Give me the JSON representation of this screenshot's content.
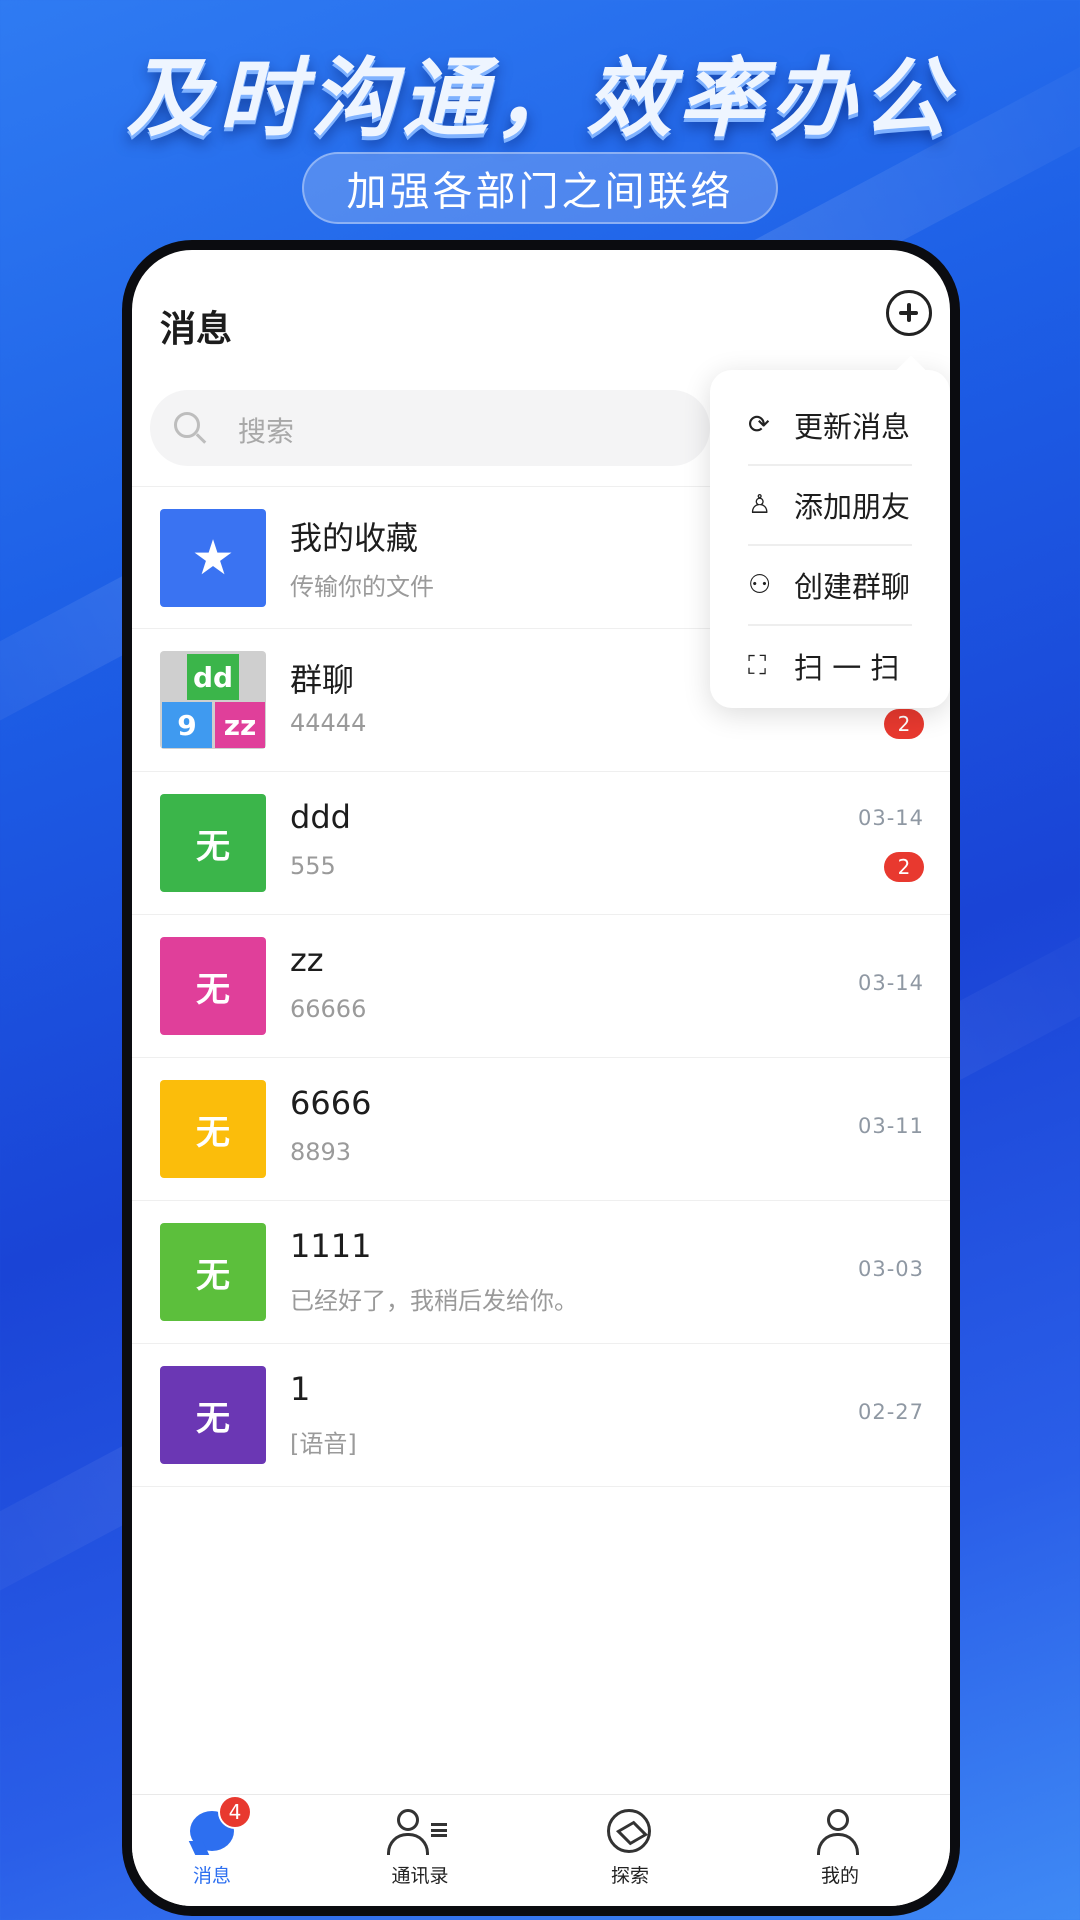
{
  "promo": {
    "headline": "及时沟通，效率办公",
    "subtitle": "加强各部门之间联络"
  },
  "header": {
    "title": "消息",
    "add_icon": "plus-circle-icon"
  },
  "search": {
    "placeholder": "搜索",
    "icon": "search-icon"
  },
  "popup_menu": {
    "items": [
      {
        "label": "更新消息",
        "icon": "refresh-icon",
        "glyph": "⟳"
      },
      {
        "label": "添加朋友",
        "icon": "add-user-icon",
        "glyph": "♙"
      },
      {
        "label": "创建群聊",
        "icon": "group-icon",
        "glyph": "⚇"
      },
      {
        "label": "扫 一 扫",
        "icon": "scan-icon",
        "glyph": "⛶"
      }
    ]
  },
  "conversations": [
    {
      "name": "我的收藏",
      "preview": "传输你的文件",
      "time": "",
      "badge": "",
      "avatar_text": "★",
      "avatar_color": "#3a73f2"
    },
    {
      "name": "群聊",
      "preview": "44444",
      "time": "",
      "badge": "2",
      "avatar_group": [
        "dd",
        "9",
        "zz"
      ]
    },
    {
      "name": "ddd",
      "preview": "555",
      "time": "03-14",
      "badge": "2",
      "avatar_text": "无",
      "avatar_color": "#3bb54a"
    },
    {
      "name": "zz",
      "preview": "66666",
      "time": "03-14",
      "badge": "",
      "avatar_text": "无",
      "avatar_color": "#e03f9a"
    },
    {
      "name": "6666",
      "preview": "8893",
      "time": "03-11",
      "badge": "",
      "avatar_text": "无",
      "avatar_color": "#fbbd0b"
    },
    {
      "name": "1111",
      "preview": "已经好了，我稍后发给你。",
      "time": "03-03",
      "badge": "",
      "avatar_text": "无",
      "avatar_color": "#5cbf3c"
    },
    {
      "name": "1",
      "preview": "[语音]",
      "time": "02-27",
      "badge": "",
      "avatar_text": "无",
      "avatar_color": "#6b37b4"
    }
  ],
  "tabbar": {
    "tabs": [
      {
        "label": "消息",
        "icon": "chat-icon",
        "badge": "4",
        "active": true
      },
      {
        "label": "通讯录",
        "icon": "contacts-icon"
      },
      {
        "label": "探索",
        "icon": "compass-icon"
      },
      {
        "label": "我的",
        "icon": "profile-icon"
      }
    ]
  },
  "colors": {
    "accent": "#2d6ff0",
    "badge": "#e8392f"
  }
}
